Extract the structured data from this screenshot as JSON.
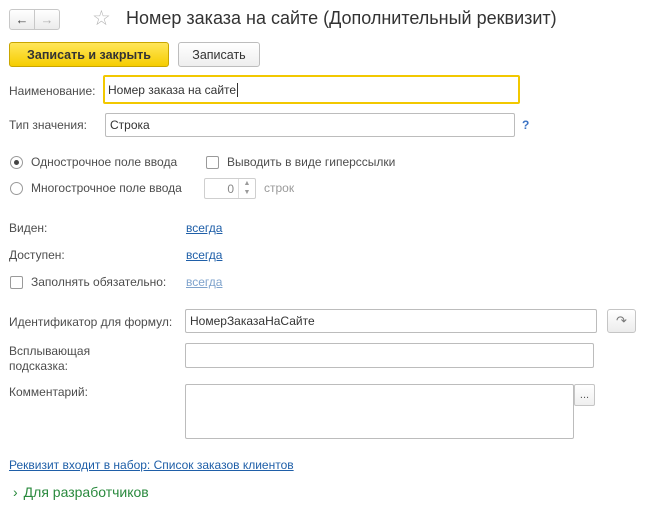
{
  "header": {
    "title": "Номер заказа на сайте (Дополнительный реквизит)",
    "back_icon": "←",
    "forward_icon": "→",
    "favorite_icon": "☆"
  },
  "toolbar": {
    "save_close_label": "Записать и закрыть",
    "save_label": "Записать"
  },
  "form": {
    "name_label": "Наименование:",
    "name_value": "Номер заказа на сайте",
    "type_label": "Тип значения:",
    "type_value": "Строка",
    "type_help": "?",
    "single_line_label": "Однострочное поле ввода",
    "hyperlink_label": "Выводить в виде гиперссылки",
    "multi_line_label": "Многострочное поле ввода",
    "lines_count": "0",
    "lines_unit": "строк",
    "visible_label": "Виден:",
    "visible_value": "всегда",
    "available_label": "Доступен:",
    "available_value": "всегда",
    "required_label": "Заполнять обязательно:",
    "required_value": "всегда",
    "formula_id_label": "Идентификатор для формул:",
    "formula_id_value": "НомерЗаказаНаСайте",
    "tooltip_label_1": "Всплывающая",
    "tooltip_label_2": "подсказка:",
    "tooltip_value": "",
    "comment_label": "Комментарий:",
    "comment_value": "",
    "comment_button": "...",
    "set_link": "Реквизит входит в набор: Список заказов клиентов",
    "developers_section": "Для разработчиков"
  },
  "colors": {
    "accent_yellow": "#f6cd00",
    "link_blue": "#1f5fa8",
    "section_green": "#2a8a3e"
  }
}
